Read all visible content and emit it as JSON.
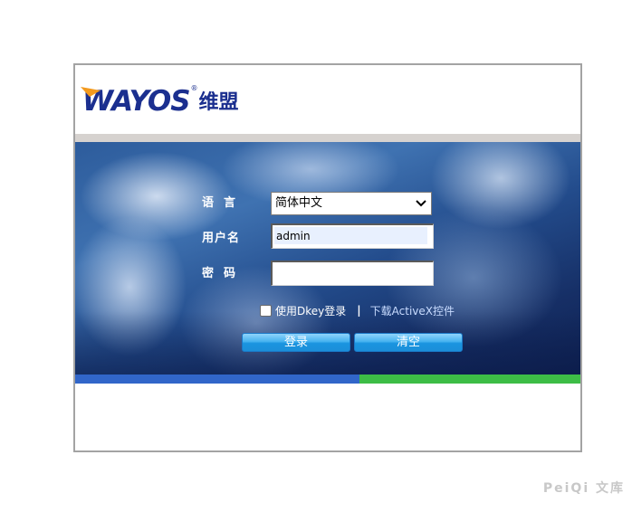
{
  "brand": {
    "logo_text": "WAYOS",
    "logo_reg": "®",
    "logo_cn": "维盟"
  },
  "form": {
    "language_label": "语言",
    "language_selected": "简体中文",
    "username_label": "用户名",
    "username_value": "admin",
    "password_label": "密码",
    "password_value": "",
    "dkey_label": "使用Dkey登录",
    "separator": "|",
    "activex_link": "下载ActiveX控件",
    "login_button": "登录",
    "clear_button": "清空"
  },
  "watermark": "PeiQi 文库",
  "colors": {
    "brand_blue": "#1b2f8f",
    "brand_orange": "#f39a1e",
    "bar_blue": "#3166c9",
    "bar_green": "#3dbd46",
    "button": "#1b8fd9"
  },
  "icons": {
    "select_arrow": "chevron-down-icon"
  }
}
